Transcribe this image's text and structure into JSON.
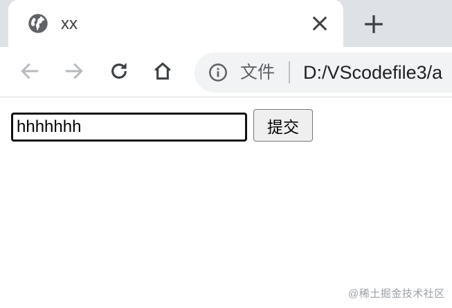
{
  "tab": {
    "title": "xx",
    "favicon_icon": "globe-icon",
    "close_icon": "close-icon"
  },
  "tabstrip": {
    "new_tab_icon": "plus-icon"
  },
  "toolbar": {
    "back_icon": "arrow-left-icon",
    "forward_icon": "arrow-right-icon",
    "reload_icon": "reload-icon",
    "home_icon": "home-icon"
  },
  "omnibox": {
    "info_icon": "info-icon",
    "scheme_label": "文件",
    "url": "D:/VScodefile3/a"
  },
  "form": {
    "input_value": "hhhhhhh",
    "submit_label": "提交"
  },
  "watermark": "@稀土掘金技术社区",
  "colors": {
    "tabstrip_bg": "#dee1e6",
    "omnibox_bg": "#f1f3f4",
    "disabled_icon": "#b6b9bd",
    "active_icon": "#3c4043"
  }
}
